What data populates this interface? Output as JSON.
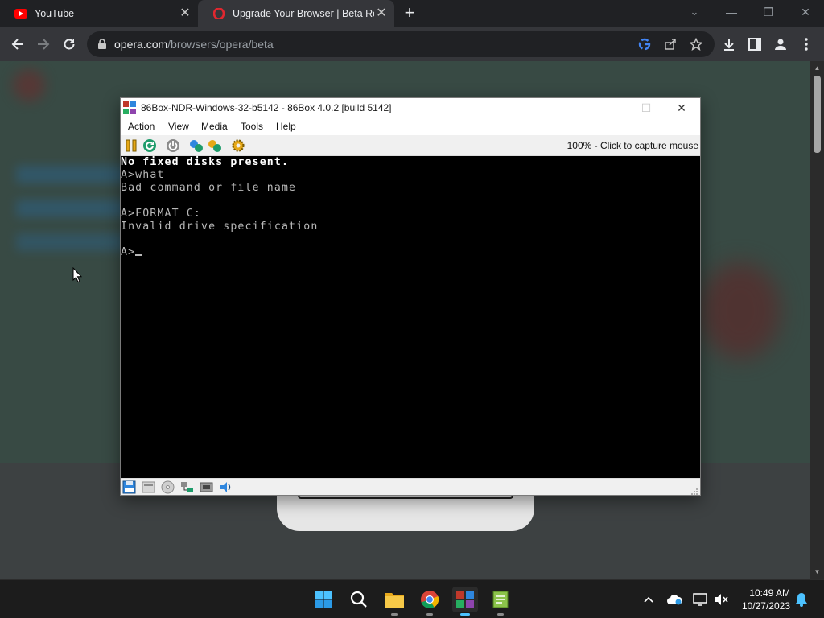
{
  "browser": {
    "tabs": [
      {
        "title": "YouTube",
        "icon": "youtube-icon",
        "active": false
      },
      {
        "title": "Upgrade Your Browser | Beta Release",
        "icon": "opera-icon",
        "active": true
      }
    ],
    "url_host": "opera.com",
    "url_path": "/browsers/opera/beta"
  },
  "emulator": {
    "window_title": "86Box-NDR-Windows-32-b5142 - 86Box 4.0.2 [build 5142]",
    "menu": [
      "Action",
      "View",
      "Media",
      "Tools",
      "Help"
    ],
    "capture_status": "100% - Click to capture mouse",
    "console_lines": [
      {
        "text": "No fixed disks present.",
        "bright": true
      },
      {
        "text": "A>what",
        "bright": false
      },
      {
        "text": "Bad command or file name",
        "bright": false
      },
      {
        "text": "",
        "bright": false
      },
      {
        "text": "A>FORMAT C:",
        "bright": false
      },
      {
        "text": "Invalid drive specification",
        "bright": false
      },
      {
        "text": "",
        "bright": false
      },
      {
        "text": "A>",
        "bright": false
      }
    ]
  },
  "taskbar": {
    "time": "10:49 AM",
    "date": "10/27/2023"
  },
  "colors": {
    "console_bg": "#000000",
    "console_fg": "#b8b8b8",
    "chrome_dark": "#202124",
    "accent": "#4cc2ff"
  }
}
